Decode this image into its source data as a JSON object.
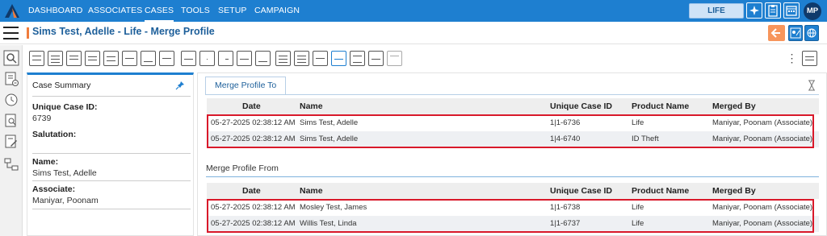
{
  "nav": {
    "items": [
      "DASHBOARD",
      "ASSOCIATES",
      "CASES",
      "TOOLS",
      "SETUP",
      "CAMPAIGN"
    ],
    "active": "CASES",
    "product_button": "LIFE",
    "avatar_initials": "MP"
  },
  "header": {
    "title": "Sims Test, Adelle - Life - Merge Profile"
  },
  "summary": {
    "heading": "Case Summary",
    "fields": [
      {
        "label": "Unique Case ID:",
        "value": "6739"
      },
      {
        "label": "Salutation:",
        "value": ""
      },
      {
        "label": "Name:",
        "value": "Sims Test, Adelle"
      },
      {
        "label": "Associate:",
        "value": "Maniyar, Poonam"
      }
    ]
  },
  "main": {
    "tab_label": "Merge Profile To",
    "columns": [
      "Date",
      "Name",
      "Unique Case ID",
      "Product Name",
      "Merged By"
    ],
    "merge_to_rows": [
      [
        "05-27-2025 02:38:12 AM",
        "Sims Test, Adelle",
        "1|1-6736",
        "Life",
        "Maniyar, Poonam (Associate)"
      ],
      [
        "05-27-2025 02:38:12 AM",
        "Sims Test, Adelle",
        "1|4-6740",
        "ID Theft",
        "Maniyar, Poonam (Associate)"
      ]
    ],
    "merge_from_title": "Merge Profile From",
    "merge_from_rows": [
      [
        "05-27-2025 02:38:12 AM",
        "Mosley Test, James",
        "1|1-6738",
        "Life",
        "Maniyar, Poonam (Associate)"
      ],
      [
        "05-27-2025 02:38:12 AM",
        "Willis Test, Linda",
        "1|1-6737",
        "Life",
        "Maniyar, Poonam (Associate)"
      ]
    ]
  },
  "colors": {
    "nav_bg": "#1e7fd0",
    "title_text": "#1d5f9a",
    "accent_orange": "#f07c3c",
    "highlight_red": "#d9192a"
  }
}
